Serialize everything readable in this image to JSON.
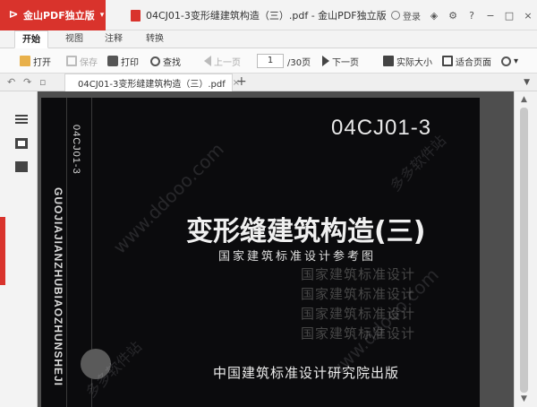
{
  "app": {
    "brand_logo": "⊳",
    "brand_name": "金山PDF独立版",
    "brand_caret": "▾",
    "window_title": "04CJ01-3变形缝建筑构造（三）.pdf - 金山PDF独立版",
    "login_label": "登录",
    "accent_color": "#d9332c"
  },
  "menu": {
    "tabs": [
      {
        "label": "开始",
        "active": true
      },
      {
        "label": "视图",
        "active": false
      },
      {
        "label": "注释",
        "active": false
      },
      {
        "label": "转换",
        "active": false
      }
    ]
  },
  "toolbar": {
    "open": "打开",
    "save": "保存",
    "print": "打印",
    "find": "查找",
    "prev_page": "上一页",
    "page_current": "1",
    "page_total": "/30页",
    "next_page": "下一页",
    "actual_size": "实际大小",
    "fit_page": "适合页面"
  },
  "doc_tab": {
    "label": "04CJ01-3变形缝建筑构造（三）.pdf",
    "close": "×",
    "new_tab": "+"
  },
  "cover": {
    "code": "04CJ01-3",
    "side_code": "04CJ01-3",
    "pinyin": "GUOJIAJIANZHUBIAOZHUNSHEJI",
    "title": "变形缝建筑构造(三)",
    "subtitle": "国家建筑标准设计参考图",
    "echo_line": "国家建筑标准设计",
    "publisher": "中国建筑标准设计研究院出版"
  },
  "watermark": {
    "text1": "www.ddooo.com",
    "text2": "多多软件站"
  }
}
